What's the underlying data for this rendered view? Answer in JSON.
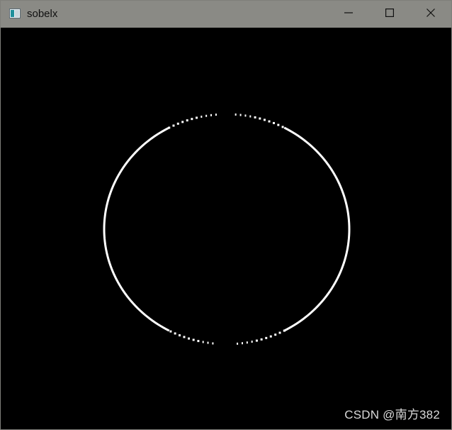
{
  "window": {
    "title": "sobelx",
    "icons": {
      "app": "opencv-window-icon",
      "minimize": "minimize-icon",
      "maximize": "maximize-icon",
      "close": "close-icon"
    },
    "colors": {
      "titlebar": "#8a8a85",
      "canvas": "#000000",
      "edge": "#ffffff"
    }
  },
  "canvas": {
    "content": "sobel-x edge outline of a circle"
  },
  "watermark": {
    "text": "CSDN @南方382"
  }
}
